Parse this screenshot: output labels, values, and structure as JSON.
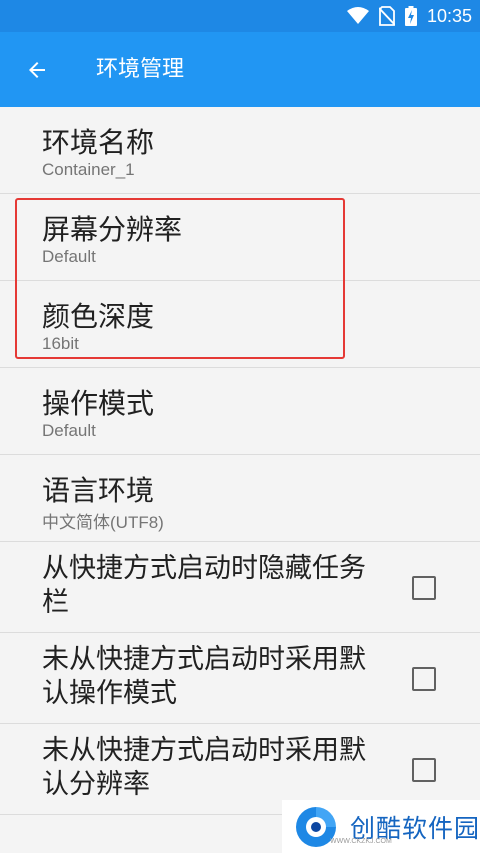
{
  "status_bar": {
    "time": "10:35",
    "icons": [
      "wifi-icon",
      "no-sim-icon",
      "battery-charging-icon"
    ]
  },
  "toolbar": {
    "title": "环境管理",
    "back_icon": "arrow-back-icon"
  },
  "preferences": [
    {
      "title": "环境名称",
      "summary": "Container_1"
    },
    {
      "title": "屏幕分辨率",
      "summary": "Default"
    },
    {
      "title": "颜色深度",
      "summary": "16bit"
    },
    {
      "title": "操作模式",
      "summary": "Default"
    },
    {
      "title": "语言环境",
      "summary": "中文简体(UTF8)"
    }
  ],
  "checkbox_preferences": [
    {
      "title": "从快捷方式启动时隐藏任务栏",
      "checked": false
    },
    {
      "title": "未从快捷方式启动时采用默认操作模式",
      "checked": false
    },
    {
      "title": "未从快捷方式启动时采用默认分辨率",
      "checked": false
    }
  ],
  "watermark": {
    "brand": "创酷软件园",
    "url": "WWW.CKZKJ.COM"
  },
  "colors": {
    "status_bar": "#1e88e5",
    "toolbar": "#2196f3",
    "highlight": "#e53935",
    "background": "#f4f4f4"
  }
}
